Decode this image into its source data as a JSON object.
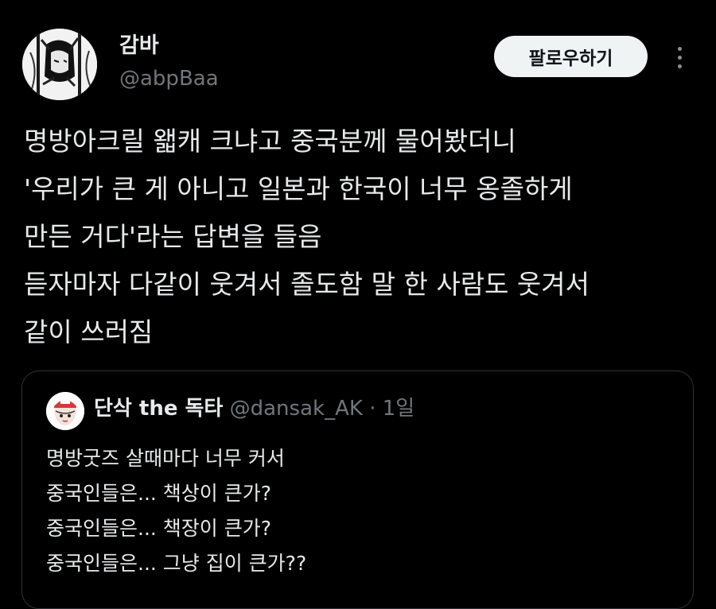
{
  "tweet": {
    "author": {
      "display_name": "감바",
      "handle": "@abpBaa",
      "avatar_icon": "manga-avatar-icon"
    },
    "follow_label": "팔로우하기",
    "more_icon": "more-options-icon",
    "text_lines": [
      "명방아크릴 왧캐 크냐고 중국분께 물어봤더니",
      "'우리가 큰 게 아니고 일본과 한국이 너무 옹졸하게",
      "만든 거다'라는 답변을 들음",
      "듣자마자 다같이 웃겨서 졸도함 말 한 사람도 웃겨서",
      "같이 쓰러짐"
    ]
  },
  "quoted_tweet": {
    "author": {
      "display_name": "단삭 the 독타",
      "handle": "@dansak_AK",
      "separator": "·",
      "time": "1일",
      "avatar_icon": "character-avatar-icon"
    },
    "text_lines": [
      "명방굿즈 살때마다 너무 커서",
      "중국인들은... 책상이 큰가?",
      "중국인들은... 책장이 큰가?",
      "중국인들은... 그냥 집이 큰가??"
    ]
  },
  "colors": {
    "background": "#000000",
    "text_primary": "#e7e9ea",
    "text_secondary": "#71767b",
    "follow_button_bg": "#eff3f4",
    "card_border": "#2f3336"
  }
}
